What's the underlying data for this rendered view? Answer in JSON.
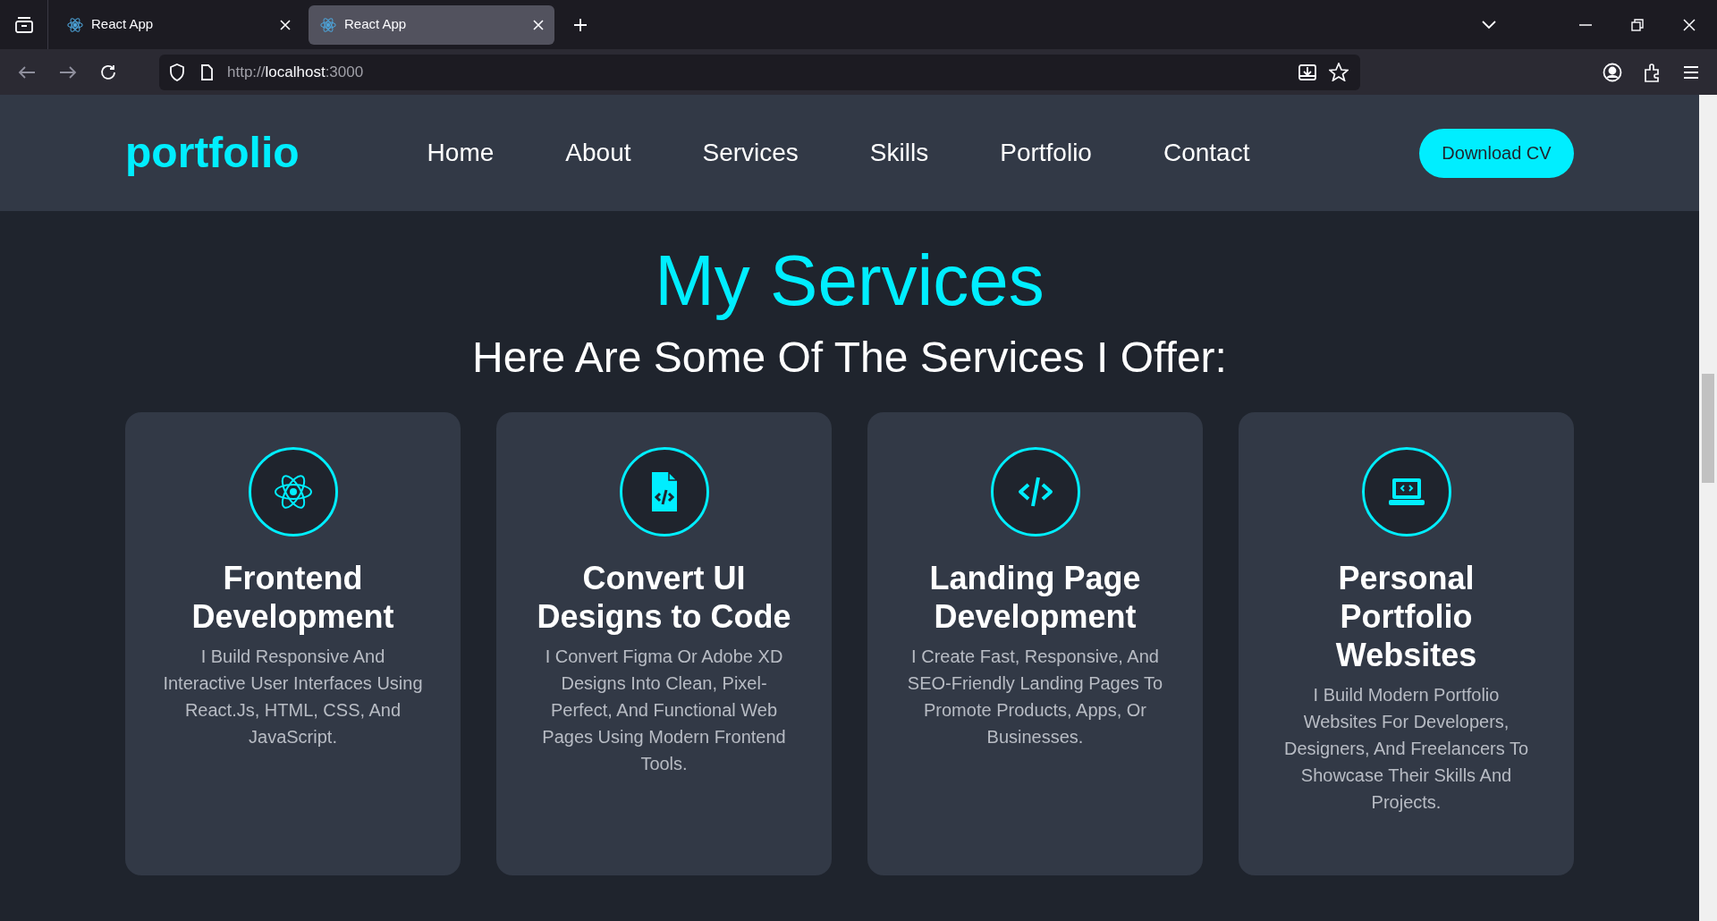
{
  "browser": {
    "tabs": [
      {
        "title": "React App",
        "selected": false
      },
      {
        "title": "React App",
        "selected": true
      }
    ],
    "address": {
      "scheme": "http://",
      "host": "localhost",
      "port": ":3000"
    }
  },
  "header": {
    "logo": "portfolio",
    "nav": [
      "Home",
      "About",
      "Services",
      "Skills",
      "Portfolio",
      "Contact"
    ],
    "button": "Download CV"
  },
  "services": {
    "title": "My Services",
    "subtitle": "Here Are Some Of The Services I Offer:",
    "cards": [
      {
        "title": "Frontend Development",
        "description": "I Build Responsive And Interactive User Interfaces Using React.Js, HTML, CSS, And JavaScript."
      },
      {
        "title": "Convert UI Designs to Code",
        "description": "I Convert Figma Or Adobe XD Designs Into Clean, Pixel-Perfect, And Functional Web Pages Using Modern Frontend Tools."
      },
      {
        "title": "Landing Page Development",
        "description": "I Create Fast, Responsive, And SEO-Friendly Landing Pages To Promote Products, Apps, Or Businesses."
      },
      {
        "title": "Personal Portfolio Websites",
        "description": "I Build Modern Portfolio Websites For Developers, Designers, And Freelancers To Showcase Their Skills And Projects."
      }
    ]
  }
}
